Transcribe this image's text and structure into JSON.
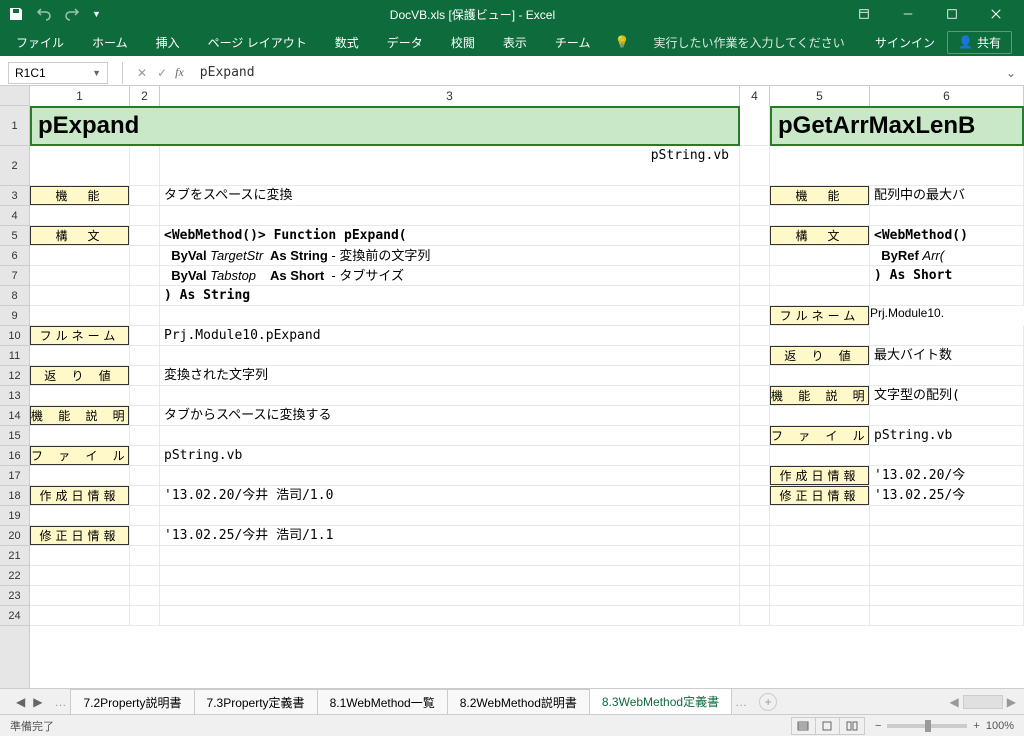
{
  "window": {
    "title": "DocVB.xls  [保護ビュー] - Excel",
    "signin": "サインイン",
    "share": "共有"
  },
  "ribbon": {
    "file": "ファイル",
    "home": "ホーム",
    "insert": "挿入",
    "pagelayout": "ページ レイアウト",
    "formulas": "数式",
    "data": "データ",
    "review": "校閲",
    "view": "表示",
    "team": "チーム",
    "tellme": "実行したい作業を入力してください"
  },
  "formula": {
    "namebox": "R1C1",
    "value": "pExpand"
  },
  "columns": {
    "c1": "1",
    "c2": "2",
    "c3": "3",
    "c4": "4",
    "c5": "5",
    "c6": "6"
  },
  "rows": [
    "1",
    "2",
    "3",
    "4",
    "5",
    "6",
    "7",
    "8",
    "9",
    "10",
    "11",
    "12",
    "13",
    "14",
    "15",
    "16",
    "17",
    "18",
    "19",
    "20",
    "21",
    "22",
    "23",
    "24"
  ],
  "sheet": {
    "title_left": "pExpand",
    "title_right": "pGetArrMaxLenB",
    "pstring": "pString.vb",
    "labels": {
      "kinou": "機　能",
      "koubun": "構　文",
      "fullname": "フルネーム",
      "kaerichi": "返 り 値",
      "kinousetsumei": "機 能 説 明",
      "filename": "フ ァ イ ル 名",
      "sakusei": "作成日情報",
      "shusei": "修正日情報"
    },
    "left": {
      "kinou": "タブをスペースに変換",
      "koubun1": "<WebMethod()> Function pExpand(",
      "koubun2a": "  ByVal ",
      "koubun2b": "TargetStr",
      "koubun2c": "  As String",
      "koubun2d": " - 変換前の文字列",
      "koubun3a": "  ByVal ",
      "koubun3b": "Tabstop",
      "koubun3c": "    As Short",
      "koubun3d": "  - タブサイズ",
      "koubun4": ") As String",
      "fullname": "Prj.Module10.pExpand",
      "kaerichi": "変換された文字列",
      "kinousetsumei": "タブからスペースに変換する",
      "filename": "pString.vb",
      "sakusei": "'13.02.20/今井 浩司/1.0",
      "shusei": "'13.02.25/今井 浩司/1.1"
    },
    "right": {
      "kinou": "配列中の最大バ",
      "koubun1": "<WebMethod()",
      "koubun2": "  ByRef Arr(",
      "koubun3": ") As Short",
      "fullname": "Prj.Module10.",
      "kaerichi": "最大バイト数",
      "kinousetsumei": "文字型の配列(",
      "filename": "pString.vb",
      "sakusei": "'13.02.20/今",
      "shusei": "'13.02.25/今"
    }
  },
  "tabs": {
    "t1": "7.2Property説明書",
    "t2": "7.3Property定義書",
    "t3": "8.1WebMethod一覧",
    "t4": "8.2WebMethod説明書",
    "t5": "8.3WebMethod定義書"
  },
  "status": {
    "ready": "準備完了",
    "zoom": "100%"
  },
  "chart_data": null
}
